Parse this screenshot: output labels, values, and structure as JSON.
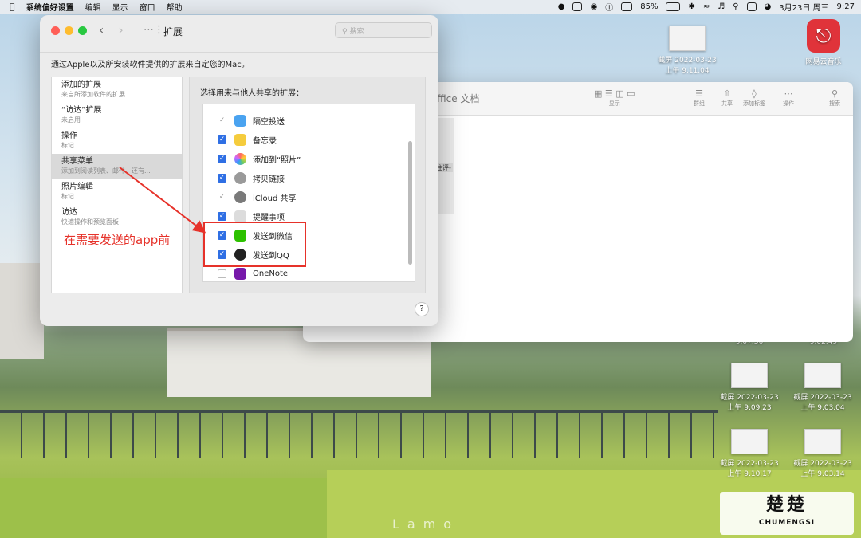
{
  "menubar": {
    "app": "系统偏好设置",
    "items": [
      "编辑",
      "显示",
      "窗口",
      "帮助"
    ],
    "battery": "85%",
    "datetime": "3月23日 周三",
    "time": "9:27"
  },
  "desktop": {
    "icons": [
      {
        "name": "截屏 2022-03-23",
        "time": "上午 9.11.04"
      },
      {
        "name": "网易云音乐",
        "time": ""
      },
      {
        "name": "截屏 2022-03-23",
        "time": "上午 9.09.23"
      },
      {
        "name": "截屏 2022-03-23",
        "time": "上午 9.03.04"
      },
      {
        "name": "截屏 2022-03-23",
        "time": "上午 9.10.17"
      },
      {
        "name": "截屏 2022-03-23",
        "time": "上午 9.03.14"
      }
    ],
    "partial_times": [
      "9.07.36",
      "9.02.49"
    ]
  },
  "finder": {
    "title": "ffice 文档",
    "tools": [
      "显示",
      "群组",
      "共享",
      "添加标签",
      "操作",
      "搜索"
    ],
    "highlight": "注评-"
  },
  "prefs": {
    "title": "扩展",
    "search_placeholder": "搜索",
    "description": "通过Apple以及所安装软件提供的扩展来自定您的Mac。",
    "left_items": [
      {
        "title": "添加的扩展",
        "sub": "来自所添加软件的扩展"
      },
      {
        "title": "“访达”扩展",
        "sub": "未启用"
      },
      {
        "title": "操作",
        "sub": "标记"
      },
      {
        "title": "共享菜单",
        "sub": "添加到阅读列表、邮件、还有..."
      },
      {
        "title": "照片编辑",
        "sub": "标记"
      },
      {
        "title": "访达",
        "sub": "快速操作和预览面板"
      }
    ],
    "right_label": "选择用来与他人共享的扩展：",
    "rows": [
      {
        "label": "隔空投送",
        "state": "dim",
        "color": "#4aa3f0"
      },
      {
        "label": "备忘录",
        "state": "on",
        "color": "#f5cc3d"
      },
      {
        "label": "添加到“照片”",
        "state": "on",
        "color": "#e96fa5"
      },
      {
        "label": "拷贝链接",
        "state": "on",
        "color": "#9a9a9a"
      },
      {
        "label": "iCloud 共享",
        "state": "dim",
        "color": "#7a7a7a"
      },
      {
        "label": "提醒事项",
        "state": "on",
        "color": "#dcdcdc"
      },
      {
        "label": "发送到微信",
        "state": "on",
        "color": "#2dc100"
      },
      {
        "label": "发送到QQ",
        "state": "on",
        "color": "#222222"
      },
      {
        "label": "OneNote",
        "state": "off",
        "color": "#7719aa"
      }
    ],
    "help": "?"
  },
  "annotation": "在需要发送的app前",
  "watermark": {
    "big": "楚楚",
    "small": "CHUMENGSI"
  },
  "lamo": "Lamo"
}
